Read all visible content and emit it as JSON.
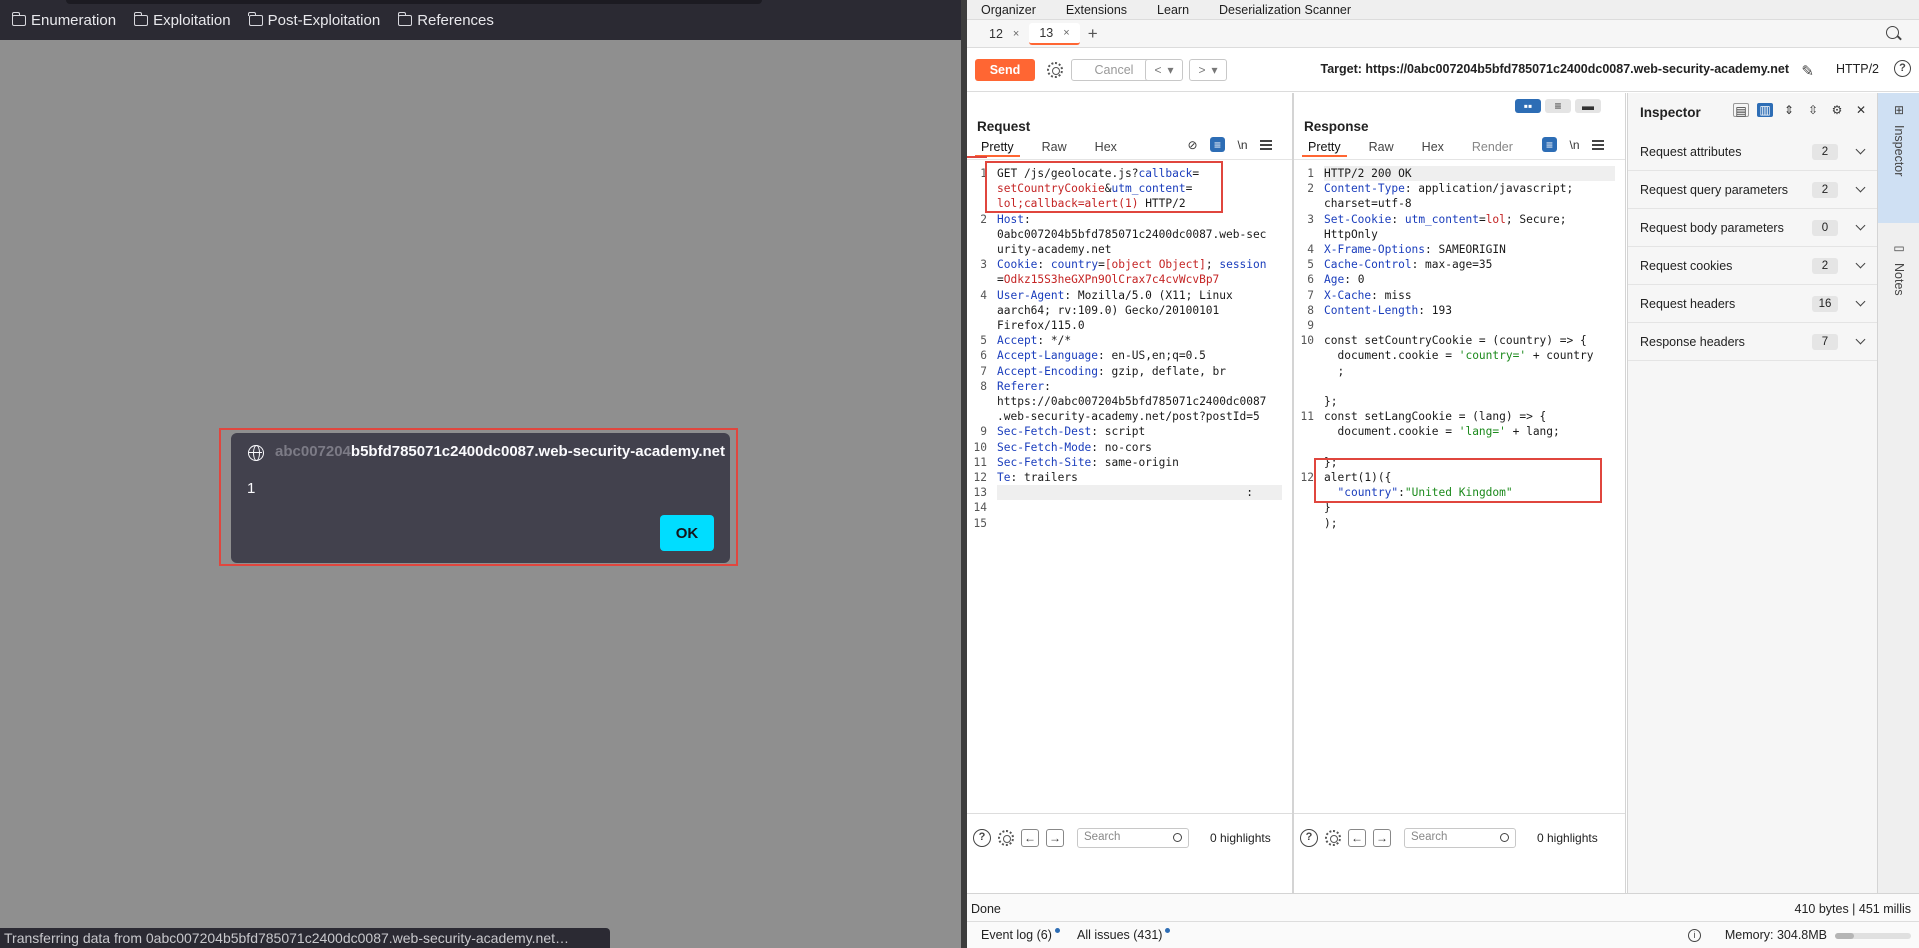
{
  "browser": {
    "bookmarks": [
      "Enumeration",
      "Exploitation",
      "Post-Exploitation",
      "References"
    ],
    "dialog": {
      "origin_faded": "abc007204",
      "origin_rest": "b5bfd785071c2400dc0087.web-security-academy.net",
      "message": "1",
      "ok_label": "OK"
    },
    "status": "Transferring data from 0abc007204b5bfd785071c2400dc0087.web-security-academy.net…"
  },
  "burp": {
    "menu": [
      "Organizer",
      "Extensions",
      "Learn",
      "Deserialization Scanner"
    ],
    "tabs": [
      {
        "label": "12",
        "close": "×"
      },
      {
        "label": "13",
        "close": "×"
      }
    ],
    "add_tab": "+",
    "toolbar": {
      "send": "Send",
      "cancel": "Cancel",
      "back": "<",
      "back_drop": "▾",
      "fwd": ">",
      "fwd_drop": "▾",
      "target": "Target: https://0abc007204b5bfd785071c2400dc0087.web-security-academy.net",
      "protocol": "HTTP/2",
      "help": "?"
    },
    "request": {
      "title": "Request",
      "subtabs": [
        "Pretty",
        "Raw",
        "Hex"
      ],
      "newline": "\\n",
      "search_placeholder": "Search",
      "highlights": "0 highlights"
    },
    "response": {
      "title": "Response",
      "subtabs": [
        "Pretty",
        "Raw",
        "Hex",
        "Render"
      ],
      "newline": "\\n",
      "search_placeholder": "Search",
      "highlights": "0 highlights"
    },
    "inspector": {
      "title": "Inspector",
      "rows": [
        {
          "label": "Request attributes",
          "count": "2"
        },
        {
          "label": "Request query parameters",
          "count": "2"
        },
        {
          "label": "Request body parameters",
          "count": "0"
        },
        {
          "label": "Request cookies",
          "count": "2"
        },
        {
          "label": "Request headers",
          "count": "16"
        },
        {
          "label": "Response headers",
          "count": "7"
        }
      ]
    },
    "side_tabs": [
      "Inspector",
      "Notes"
    ],
    "statusbar": {
      "done": "Done",
      "bytes": "410 bytes | 451 millis",
      "event_log": "Event log (6)",
      "all_issues": "All issues (431)",
      "memory": "Memory: 304.8MB",
      "memory_fraction": 0.25
    }
  }
}
